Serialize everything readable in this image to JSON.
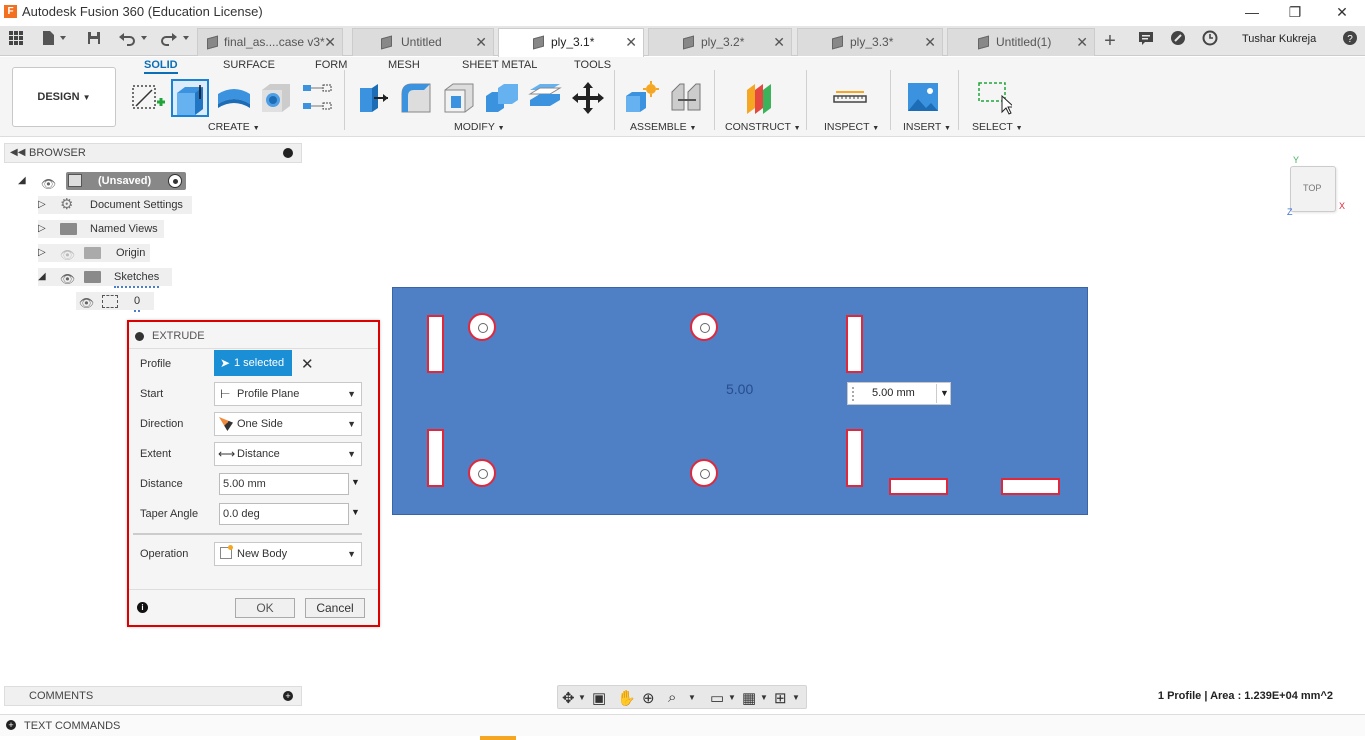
{
  "window": {
    "title": "Autodesk Fusion 360 (Education License)",
    "minimize": "—",
    "restore": "❐",
    "close": "✕"
  },
  "quick_access": {
    "user": "Tushar Kukreja"
  },
  "tabs": [
    {
      "label": "final_as....case v3*",
      "close": "✕"
    },
    {
      "label": "Untitled",
      "close": "✕"
    },
    {
      "label": "ply_3.1*",
      "close": "✕"
    },
    {
      "label": "ply_3.2*",
      "close": "✕"
    },
    {
      "label": "ply_3.3*",
      "close": "✕"
    },
    {
      "label": "Untitled(1)",
      "close": "✕"
    }
  ],
  "ribbon": {
    "workspace": "DESIGN",
    "tabs": [
      "SOLID",
      "SURFACE",
      "FORM",
      "MESH",
      "SHEET METAL",
      "TOOLS"
    ],
    "groups": [
      "CREATE",
      "MODIFY",
      "ASSEMBLE",
      "CONSTRUCT",
      "INSPECT",
      "INSERT",
      "SELECT"
    ]
  },
  "browser": {
    "title": "BROWSER",
    "root": "(Unsaved)",
    "items": [
      "Document Settings",
      "Named Views",
      "Origin",
      "Sketches"
    ],
    "sketch": "0"
  },
  "extrude": {
    "title": "EXTRUDE",
    "labels": {
      "profile": "Profile",
      "start": "Start",
      "direction": "Direction",
      "extent": "Extent",
      "distance": "Distance",
      "taper": "Taper Angle",
      "operation": "Operation"
    },
    "profile_value": "1 selected",
    "start_value": "Profile Plane",
    "direction_value": "One Side",
    "extent_value": "Distance",
    "distance_value": "5.00 mm",
    "taper_value": "0.0 deg",
    "operation_value": "New Body",
    "ok": "OK",
    "cancel": "Cancel"
  },
  "canvas": {
    "dimension_label": "5.00",
    "dimension_input": "5.00 mm",
    "viewcube": "TOP",
    "axis_y": "Y",
    "axis_x": "X",
    "axis_z": "Z"
  },
  "comments": {
    "title": "COMMENTS"
  },
  "text_commands": {
    "title": "TEXT COMMANDS"
  },
  "status": {
    "text": "1 Profile | Area : 1.239E+04 mm^2"
  }
}
